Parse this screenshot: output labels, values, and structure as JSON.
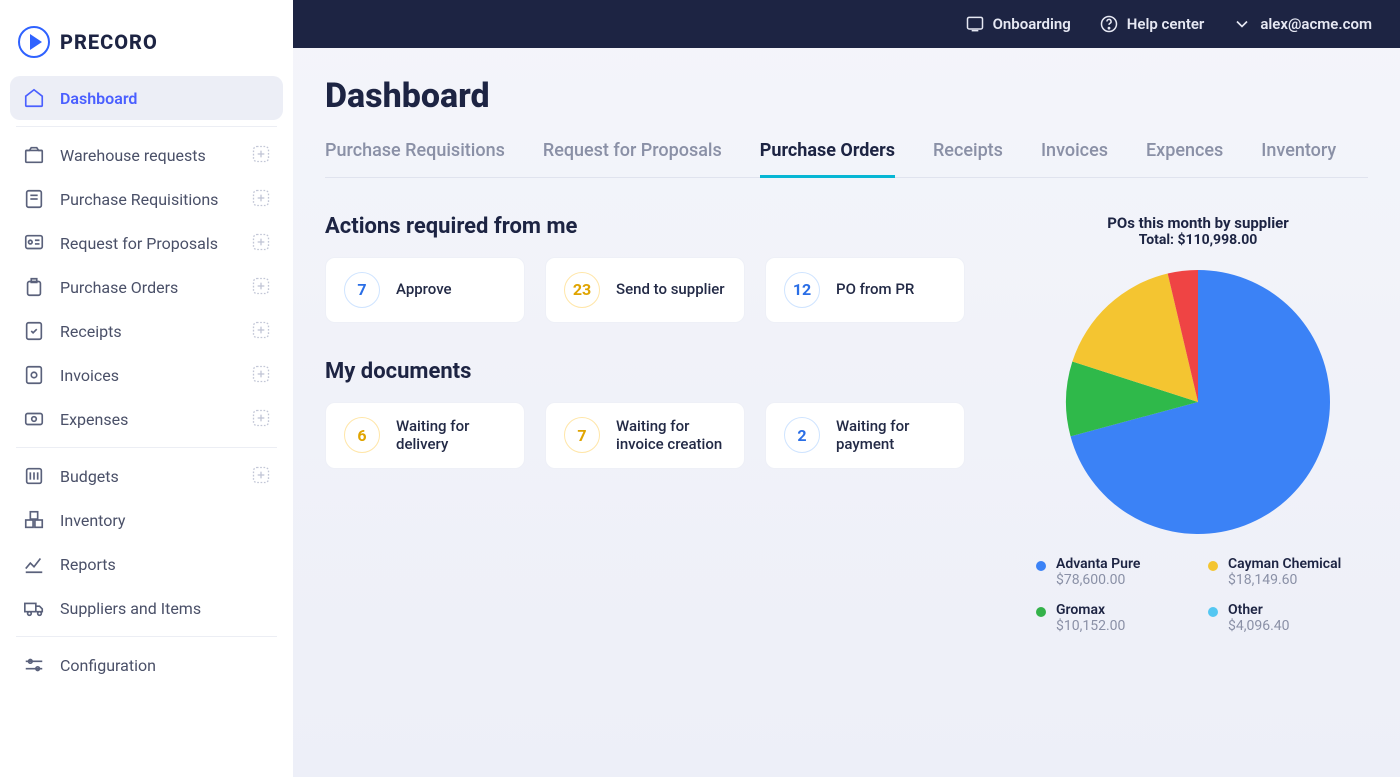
{
  "brand": "PRECORO",
  "topbar": {
    "onboarding": "Onboarding",
    "help": "Help center",
    "user": "alex@acme.com"
  },
  "sidebar": {
    "dashboard": "Dashboard",
    "items": [
      {
        "label": "Warehouse requests",
        "icon": "warehouse"
      },
      {
        "label": "Purchase Requisitions",
        "icon": "requisition"
      },
      {
        "label": "Request for Proposals",
        "icon": "rfp"
      },
      {
        "label": "Purchase Orders",
        "icon": "po"
      },
      {
        "label": "Receipts",
        "icon": "receipt"
      },
      {
        "label": "Invoices",
        "icon": "invoice"
      },
      {
        "label": "Expenses",
        "icon": "expense"
      }
    ],
    "group2": [
      {
        "label": "Budgets",
        "icon": "budget",
        "plus": true
      },
      {
        "label": "Inventory",
        "icon": "inventory"
      },
      {
        "label": "Reports",
        "icon": "reports"
      },
      {
        "label": "Suppliers and Items",
        "icon": "truck"
      }
    ],
    "config": "Configuration"
  },
  "page": {
    "title": "Dashboard"
  },
  "tabs": [
    "Purchase Requisitions",
    "Request for Proposals",
    "Purchase Orders",
    "Receipts",
    "Invoices",
    "Expences",
    "Inventory"
  ],
  "active_tab": 2,
  "sections": {
    "actions_title": "Actions required from me",
    "actions": [
      {
        "count": "7",
        "label": "Approve",
        "color": "blue"
      },
      {
        "count": "23",
        "label": "Send to supplier",
        "color": "amber"
      },
      {
        "count": "12",
        "label": "PO from PR",
        "color": "blue"
      }
    ],
    "docs_title": "My documents",
    "docs": [
      {
        "count": "6",
        "label": "Waiting for delivery",
        "color": "amber"
      },
      {
        "count": "7",
        "label": "Waiting for invoice creation",
        "color": "amber"
      },
      {
        "count": "2",
        "label": "Waiting for payment",
        "color": "blue"
      }
    ]
  },
  "chart_data": {
    "type": "pie",
    "title": "POs this month by supplier",
    "subtitle": "Total: $110,998.00",
    "series": [
      {
        "name": "Advanta Pure",
        "value": 78600.0,
        "value_label": "$78,600.00",
        "color": "#3b82f6"
      },
      {
        "name": "Cayman Chemical",
        "value": 18149.6,
        "value_label": "$18,149.60",
        "color": "#f4c531"
      },
      {
        "name": "Gromax",
        "value": 10152.0,
        "value_label": "$10,152.00",
        "color": "#34b24a"
      },
      {
        "name": "Other",
        "value": 4096.4,
        "value_label": "$4,096.40",
        "color": "#54c7f2"
      }
    ]
  }
}
